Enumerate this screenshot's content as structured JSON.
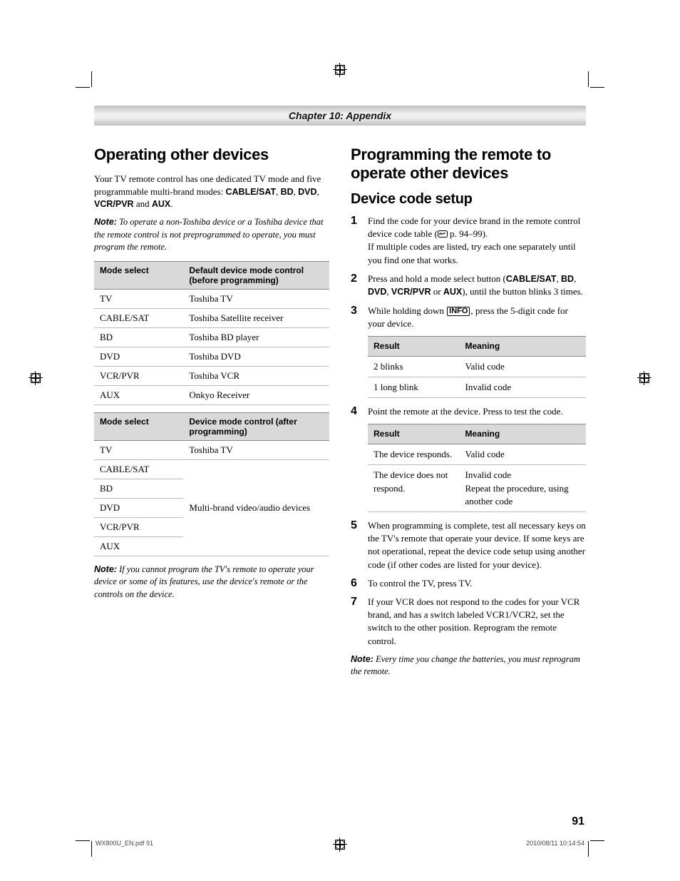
{
  "chapter": "Chapter 10: Appendix",
  "page_number": "91",
  "footer_left": "WX800U_EN.pdf   91",
  "footer_right": "2010/08/11   10:14:54",
  "left": {
    "h1": "Operating other devices",
    "intro_a": "Your TV remote control has one dedicated TV mode and five programmable multi-brand modes: ",
    "intro_b_bold": "CABLE/SAT",
    "intro_c": ", ",
    "intro_d_bold": "BD",
    "intro_e": ", ",
    "intro_f_bold": "DVD",
    "intro_g": ", ",
    "intro_h_bold": "VCR/PVR",
    "intro_i": " and ",
    "intro_j_bold": "AUX",
    "intro_k": ".",
    "note1_label": "Note:",
    "note1_text": " To operate a non-Toshiba device or a Toshiba device that the remote control is not preprogrammed to operate, you must program the remote.",
    "table1": {
      "h1": "Mode select",
      "h2": "Default device mode control (before programming)",
      "rows": [
        {
          "a": "TV",
          "b": "Toshiba TV"
        },
        {
          "a": "CABLE/SAT",
          "b": "Toshiba Satellite receiver"
        },
        {
          "a": "BD",
          "b": "Toshiba BD player"
        },
        {
          "a": "DVD",
          "b": "Toshiba DVD"
        },
        {
          "a": "VCR/PVR",
          "b": "Toshiba VCR"
        },
        {
          "a": "AUX",
          "b": "Onkyo Receiver"
        }
      ]
    },
    "table2": {
      "h1": "Mode select",
      "h2": "Device mode control (after programming)",
      "first": {
        "a": "TV",
        "b": "Toshiba TV"
      },
      "merged_value": "Multi-brand video/audio devices",
      "merged_rows": [
        "CABLE/SAT",
        "BD",
        "DVD",
        "VCR/PVR",
        "AUX"
      ]
    },
    "note2_label": "Note:",
    "note2_text": " If you cannot program the TV's remote to operate your device or some of its features, use the device's remote or the controls on the device."
  },
  "right": {
    "h1": "Programming the remote to operate other devices",
    "h2": "Device code setup",
    "step1_a": "Find the code for your device brand in the remote control device code table (",
    "step1_ref": "☞",
    "step1_b": " p. 94–99).",
    "step1_c": "If multiple codes are listed, try each one separately until you find one that works.",
    "step2_a": "Press and hold a mode select button (",
    "step2_b_bold": "CABLE/SAT",
    "step2_c": ", ",
    "step2_d_bold": "BD",
    "step2_e": ", ",
    "step2_f_bold": "DVD",
    "step2_g": ", ",
    "step2_h_bold": "VCR/PVR",
    "step2_i": " or ",
    "step2_j_bold": "AUX",
    "step2_k": "), until the button blinks 3 times.",
    "step3_a": "While holding down ",
    "step3_info": "INFO",
    "step3_b": ", press the 5-digit code for your device.",
    "table3": {
      "h1": "Result",
      "h2": "Meaning",
      "rows": [
        {
          "a": "2 blinks",
          "b": "Valid code"
        },
        {
          "a": "1 long blink",
          "b": "Invalid code"
        }
      ]
    },
    "step4": "Point the remote at the device. Press to test the code.",
    "table4": {
      "h1": "Result",
      "h2": "Meaning",
      "rows": [
        {
          "a": "The device responds.",
          "b": "Valid code"
        },
        {
          "a": "The device does not respond.",
          "b": "Invalid code\nRepeat the procedure, using another code"
        }
      ]
    },
    "step5": "When programming is complete, test all necessary keys on the TV's remote that operate your device. If some keys are not operational, repeat the device code setup using another code (if other codes are listed for your device).",
    "step6": "To control the TV, press TV.",
    "step7": "If your VCR does not respond to the codes for your VCR brand, and has a switch labeled VCR1/VCR2, set the switch to the other position. Reprogram the remote control.",
    "note3_label": "Note:",
    "note3_text": " Every time you change the batteries, you must reprogram the remote."
  }
}
